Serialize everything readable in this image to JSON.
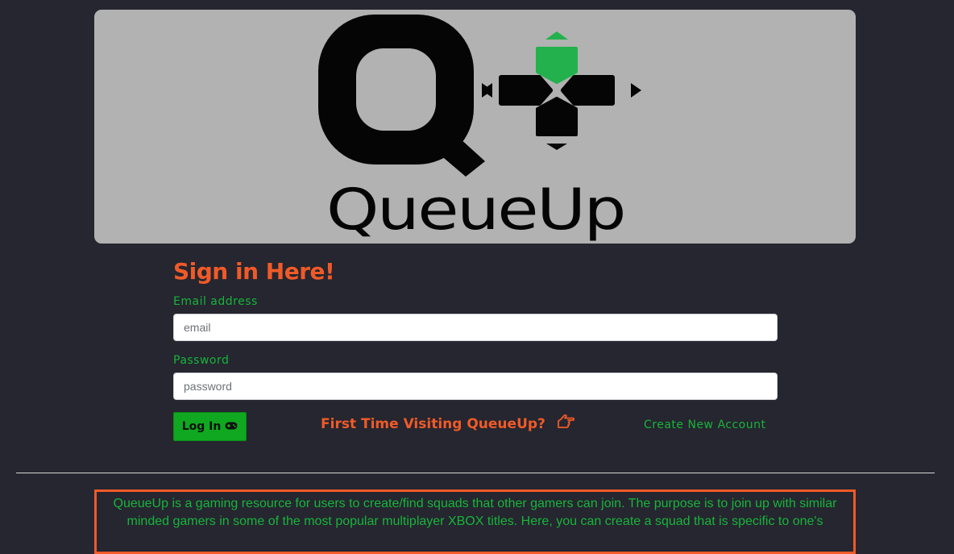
{
  "banner": {
    "logo_wordmark": "QueueUp",
    "logo_letter": "Q"
  },
  "signin": {
    "title": "Sign in Here!",
    "email_label": "Email address",
    "email_placeholder": "email",
    "email_value": "",
    "password_label": "Password",
    "password_placeholder": "password",
    "password_value": "",
    "login_label": "Log In",
    "login_icon": "gamepad-icon",
    "first_time_text": "First Time Visiting QueueUp?",
    "first_time_icon": "hand-point-right-icon",
    "create_account_label": "Create New Account"
  },
  "about": {
    "text": "QueueUp is a gaming resource for users to create/find squads that other gamers can join. The purpose is to join up with similar minded gamers in some of the most popular multiplayer XBOX titles. Here, you can create a squad that is specific to one's"
  },
  "colors": {
    "background": "#25262f",
    "banner": "#b1b2b1",
    "accent_orange": "#f05a28",
    "accent_green": "#18b43b",
    "button_green": "#0fa820",
    "dpad_active": "#22b14c"
  }
}
